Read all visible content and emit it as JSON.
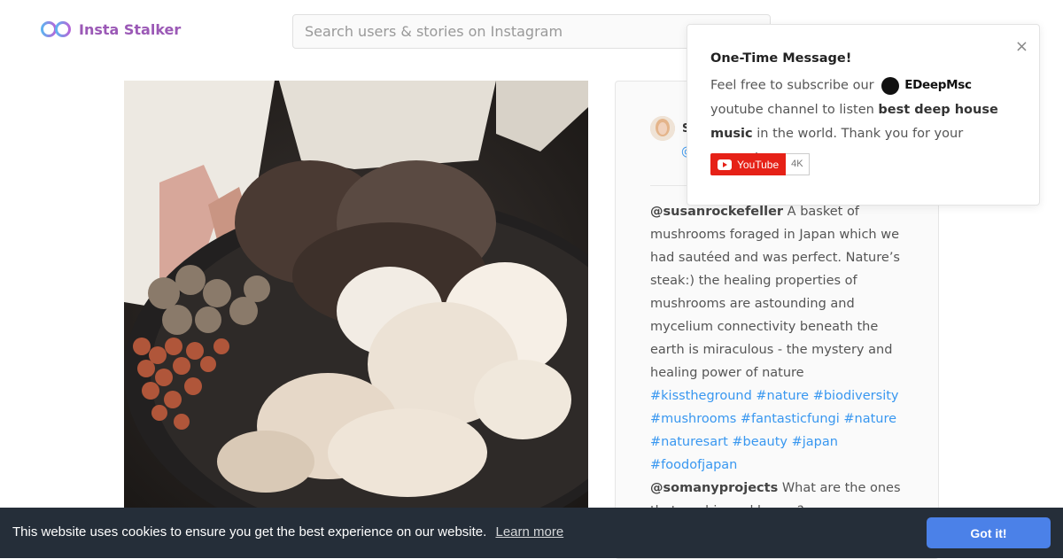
{
  "app": {
    "name": "Insta Stalker",
    "brand_color": "#9b59b6"
  },
  "search": {
    "placeholder": "Search users & stories on Instagram"
  },
  "post": {
    "author_name": "S",
    "author_handle": "@",
    "comments": [
      {
        "user": "@susanrockefeller",
        "text": "A basket of mushrooms foraged in Japan which we had sautéed and was perfect. Nature’s steak:) the healing properties of mushrooms are astounding and mycelium connectivity beneath the earth is miraculous - the mystery and healing power of nature",
        "tags": [
          "#kisstheground",
          "#nature",
          "#biodiversity",
          "#mushrooms",
          "#fantasticfungi",
          "#nature",
          "#naturesart",
          "#beauty",
          "#japan",
          "#foodofjapan"
        ]
      },
      {
        "user": "@somanyprojects",
        "text": "What are the ones that are big and brown?",
        "tags": []
      }
    ],
    "tag_color": "#3897f0"
  },
  "popup": {
    "title": "One-Time Message!",
    "text_1": "Feel free to subscribe our",
    "brand_name": "EDeepMsc",
    "text_2": "youtube channel to listen",
    "text_bold": "best deep house music",
    "text_3": "in the world. Thank you for your support.",
    "close_symbol": "×",
    "youtube_label": "YouTube",
    "youtube_count": "4K",
    "youtube_color": "#e62117"
  },
  "cookie": {
    "message": "This website uses cookies to ensure you get the best experience on our website.",
    "learn_more": "Learn more",
    "button": "Got it!",
    "bar_color": "#252e39",
    "button_color": "#4b81e8"
  }
}
